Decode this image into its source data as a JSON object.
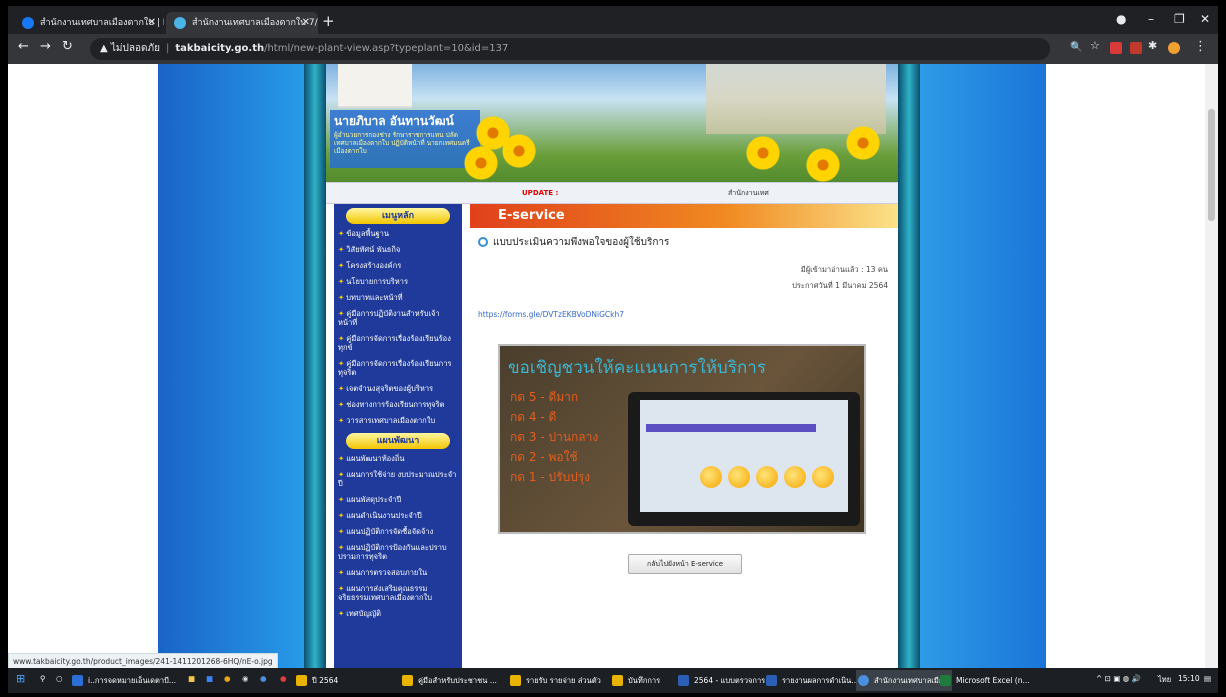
{
  "browser": {
    "tabs": [
      {
        "title": "สำนักงานเทศบาลเมืองตากใบ | Faceb",
        "active": false
      },
      {
        "title": "สำนักงานเทศบาลเมืองตากใบ 7/55 หมู่",
        "active": true
      }
    ],
    "new_tab": "+",
    "security_label": "ไม่ปลอดภัย",
    "url_host": "takbaicity.go.th",
    "url_path": "/html/new-plant-view.asp?typeplant=10&id=137"
  },
  "header": {
    "mayor_name": "นายภิบาล อันทานวัฒน์",
    "mayor_role": "ผู้อำนวยการกองช่าง รักษาราชการแทน ปลัดเทศบาลเมืองตากใบ ปฏิบัติหน้าที่ นายกเทศมนตรีเมืองตากใบ",
    "update_label": "UPDATE :",
    "ticker": "สำนักงานเทศ"
  },
  "sidebar": {
    "section1_title": "เมนูหลัก",
    "section1_items": [
      "ข้อมูลพื้นฐาน",
      "วิสัยทัศน์ พันธกิจ",
      "โครงสร้างองค์กร",
      "นโยบายการบริหาร",
      "บทบาทและหน้าที่",
      "คู่มือการปฏิบัติงานสำหรับเจ้าหน้าที่",
      "คู่มือการจัดการเรื่องร้องเรียนร้องทุกข์",
      "คู่มือการจัดการเรื่องร้องเรียนการทุจริต",
      "เจตจำนงสุจริตของผู้บริหาร",
      "ช่องทางการร้องเรียนการทุจริต",
      "วารสารเทศบาลเมืองตากใบ"
    ],
    "section2_title": "แผนพัฒนา",
    "section2_items": [
      "แผนพัฒนาท้องถิ่น",
      "แผนการใช้จ่าย งบประมาณประจำปี",
      "แผนพัสดุประจำปี",
      "แผนดำเนินงานประจำปี",
      "แผนปฏิบัติการจัดซื้อจัดจ้าง",
      "แผนปฏิบัติการป้องกันและปราบปรามการทุจริต",
      "แผนการตรวจสอบภายใน",
      "แผนการส่งเสริมคุณธรรม จริยธรรมเทศบาลเมืองตากใบ",
      "เทศบัญญัติ"
    ]
  },
  "main": {
    "section_header": "E-service",
    "post_title": "แบบประเมินความพึงพอใจของผู้ใช้บริการ",
    "views": "มีผู้เข้ามาอ่านแล้ว : 13 คน",
    "posted": "ประกาศวันที่ 1 มีนาคม 2564",
    "form_link": "https://forms.gle/DVTzEKBVoDNiGCkh7",
    "poster": {
      "title": "ขอเชิญชวนให้คะแนนการให้บริการ",
      "lines": [
        "กด 5 - ดีมาก",
        "กด 4 - ดี",
        "กด 3 - ปานกลาง",
        "กด 2 - พอใช้",
        "กด 1 - ปรับปรุง"
      ]
    },
    "back_button": "กลับไปยังหน้า E-service"
  },
  "status_url": "www.takbaicity.go.th/product_images/241-1411201268-6HQ/nE-o.jpg",
  "taskbar": {
    "items": [
      {
        "label": "i..การจดหมายเอ็นเดตาบี...",
        "color": "#2b6fd6"
      },
      {
        "label": "ปี 2564",
        "color": "#e8b400"
      },
      {
        "label": "คู่มือสำหรับประชาชน ...",
        "color": "#e8b400"
      },
      {
        "label": "รายรับ รายจ่าย ส่วนตัว",
        "color": "#e8b400"
      },
      {
        "label": "บันทึกการ",
        "color": "#e8b400"
      },
      {
        "label": "2564 - แบบตรวจการ...",
        "color": "#2b5fb5"
      },
      {
        "label": "รายงานผลการดำเนิน...",
        "color": "#2b5fb5"
      },
      {
        "label": "สำนักงานเทศบาลเมือ...",
        "color": "#4a8fe0",
        "active": true
      },
      {
        "label": "Microsoft Excel (n...",
        "color": "#1f7a3e"
      }
    ],
    "lang": "ไทย",
    "time": "15:10"
  }
}
